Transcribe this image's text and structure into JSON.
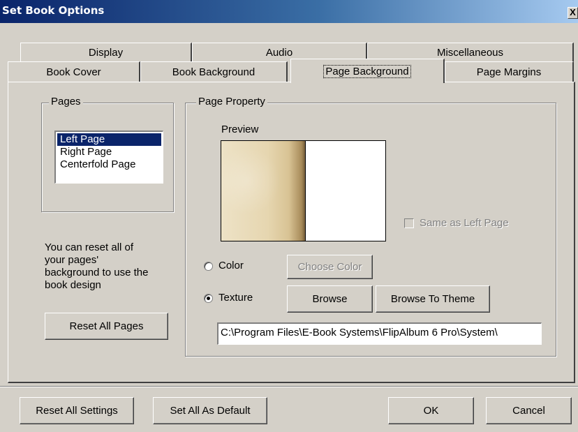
{
  "window": {
    "title": "Set Book Options",
    "close_glyph": "X"
  },
  "tabs": {
    "row_back": [
      "Display",
      "Audio",
      "Miscellaneous"
    ],
    "row_front": [
      "Book Cover",
      "Book Background",
      "Page Background",
      "Page Margins"
    ],
    "active": "Page Background"
  },
  "pages_group": {
    "legend": "Pages",
    "items": [
      "Left Page",
      "Right Page",
      "Centerfold Page"
    ],
    "selected": "Left Page"
  },
  "reset_info": "You can reset all of your pages' background to use the book design",
  "reset_info_lines": [
    "You can reset all of",
    "your pages'",
    "background to use the",
    "book design"
  ],
  "reset_all_pages_label": "Reset All Pages",
  "page_property": {
    "legend": "Page Property",
    "preview_label": "Preview",
    "same_as_left_label": "Same as Left Page",
    "same_as_left_checked": false,
    "color_label": "Color",
    "texture_label": "Texture",
    "selected_fill": "Texture",
    "choose_color_label": "Choose Color",
    "browse_label": "Browse",
    "browse_theme_label": "Browse To Theme",
    "texture_path": "C:\\Program Files\\E-Book Systems\\FlipAlbum 6 Pro\\System\\"
  },
  "footer": {
    "reset_all_settings": "Reset All Settings",
    "set_all_default": "Set All As Default",
    "ok": "OK",
    "cancel": "Cancel"
  },
  "colors": {
    "face": "#d4d0c8",
    "titlebar_start": "#0a246a",
    "titlebar_end": "#a6caf0",
    "selection": "#0a246a"
  }
}
